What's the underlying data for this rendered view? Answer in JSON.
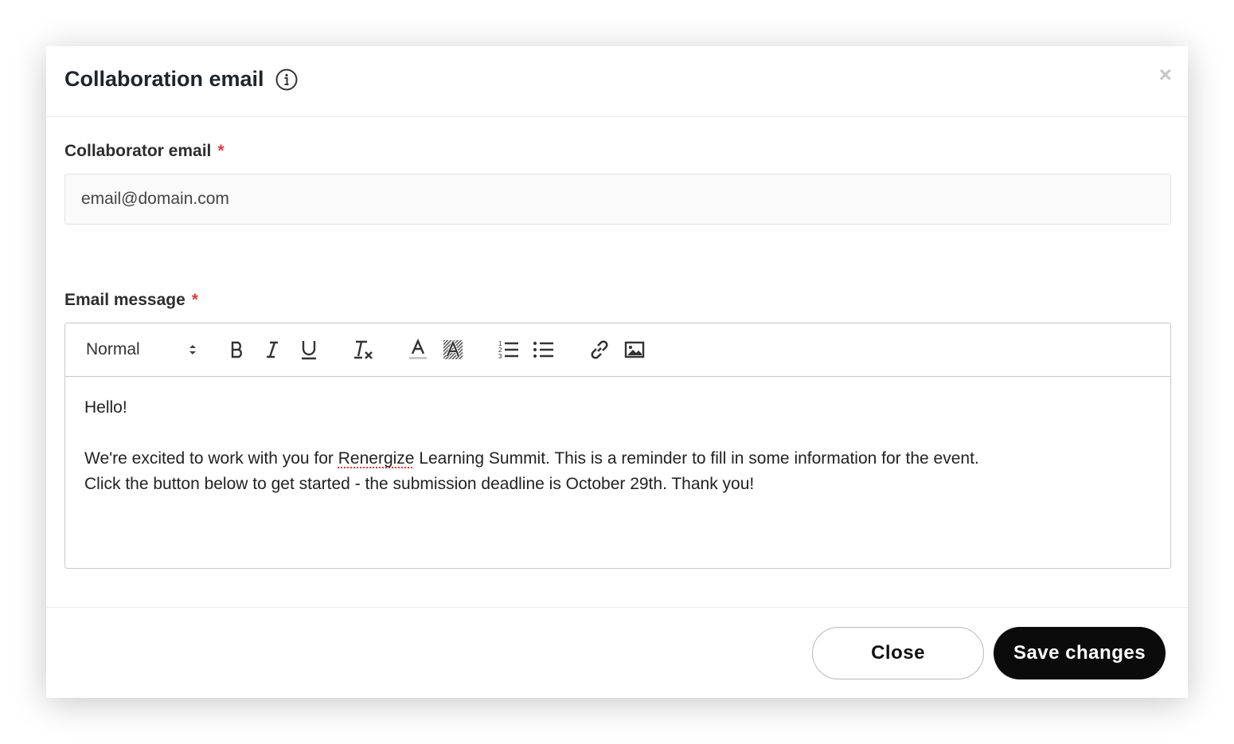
{
  "modal": {
    "title": "Collaboration email",
    "close_glyph": "×"
  },
  "collaborator_email": {
    "label": "Collaborator email",
    "required_mark": "*",
    "value": "email@domain.com"
  },
  "email_message": {
    "label": "Email message",
    "required_mark": "*",
    "toolbar": {
      "format_value": "Normal",
      "icons": [
        "bold-icon",
        "italic-icon",
        "underline-icon",
        "clear-format-icon",
        "text-color-icon",
        "background-color-icon",
        "ordered-list-icon",
        "bullet-list-icon",
        "link-icon",
        "image-icon"
      ]
    },
    "body": {
      "greeting": "Hello!",
      "line1_before": "We're excited to work with you for ",
      "line1_misspelled": "Renergize",
      "line1_after": " Learning Summit. This is a reminder to fill in some information for the event.",
      "line2": "Click the button below to get started - the submission deadline is October 29th. Thank you!"
    }
  },
  "footer": {
    "close_label": "Close",
    "save_label": "Save changes"
  },
  "colors": {
    "required": "#e03c3c",
    "primary_button": "#0b0b0b"
  }
}
